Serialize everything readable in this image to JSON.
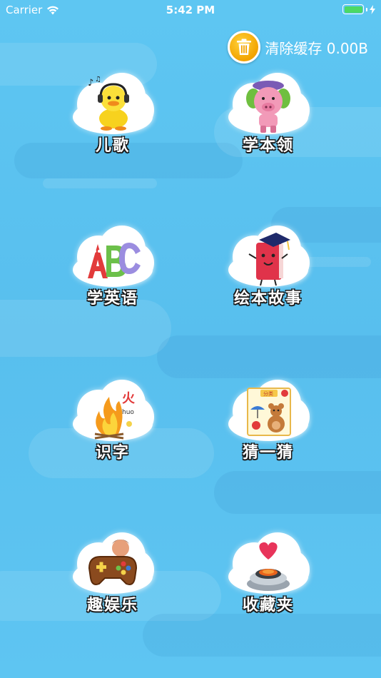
{
  "status_bar": {
    "carrier": "Carrier",
    "time": "5:42 PM",
    "battery_color": "#4cd964"
  },
  "clear_cache": {
    "label": "清除缓存 0.00B",
    "icon": "trash-icon",
    "button_color": "#f5b400"
  },
  "menu": [
    {
      "label": "儿歌",
      "icon": "duck-headphones-icon"
    },
    {
      "label": "学本领",
      "icon": "pig-toy-icon"
    },
    {
      "label": "学英语",
      "icon": "abc-letters-icon"
    },
    {
      "label": "绘本故事",
      "icon": "book-graduation-icon"
    },
    {
      "label": "识字",
      "icon": "fire-character-icon"
    },
    {
      "label": "猜一猜",
      "icon": "teddy-bear-card-icon"
    },
    {
      "label": "趣娱乐",
      "icon": "gamepad-icon"
    },
    {
      "label": "收藏夹",
      "icon": "heart-button-icon"
    }
  ],
  "colors": {
    "background": "#5cc3ef",
    "label_text": "#ffffff",
    "label_outline": "#1a1a1a"
  }
}
